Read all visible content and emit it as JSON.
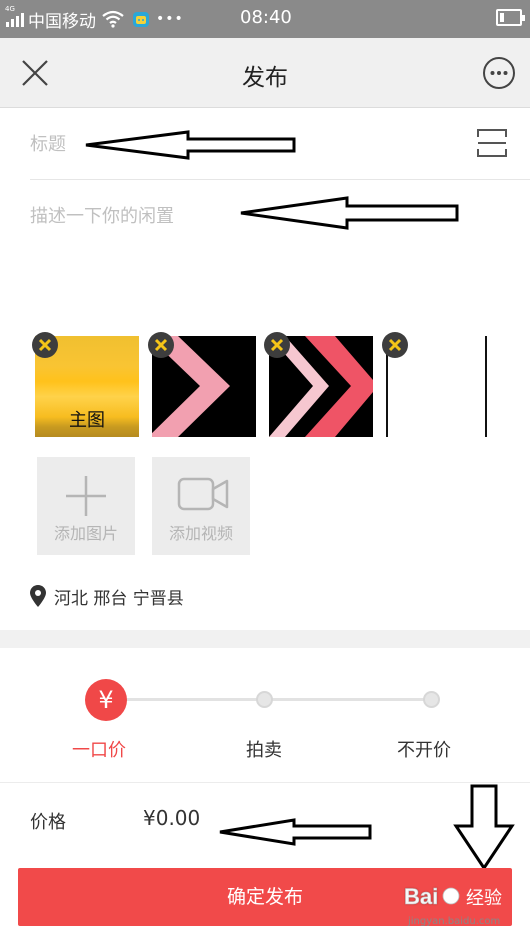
{
  "status_bar": {
    "network_type": "4G",
    "carrier": "中国移动",
    "notification_dots": "•••",
    "time": "08:40",
    "battery_level": 0.2
  },
  "nav": {
    "title": "发布",
    "close_icon": "close-icon",
    "more_icon": "more-icon"
  },
  "form": {
    "title_placeholder": "标题",
    "description_placeholder": "描述一下你的闲置",
    "scan_icon": "scan-icon"
  },
  "images": {
    "items": [
      {
        "label": "主图"
      },
      {
        "label": ""
      },
      {
        "label": ""
      },
      {
        "label": ""
      }
    ],
    "add_photo_label": "添加图片",
    "add_video_label": "添加视频"
  },
  "location": {
    "text": "河北 邢台 宁晋县",
    "icon": "location-pin-icon"
  },
  "price_type": {
    "selected_symbol": "¥",
    "options": [
      "一口价",
      "拍卖",
      "不开价"
    ],
    "selected_index": 0
  },
  "price": {
    "label": "价格",
    "value": "¥0.00"
  },
  "submit": {
    "label": "确定发布"
  },
  "watermark": {
    "text": "经验",
    "url": "jingyan.baidu.com"
  },
  "colors": {
    "accent": "#f14a4a",
    "status_bar": "#8a8a8a",
    "nav_bar": "#f0f0f0",
    "placeholder": "#c0c0c0",
    "delete_badge": "#f5c518"
  }
}
